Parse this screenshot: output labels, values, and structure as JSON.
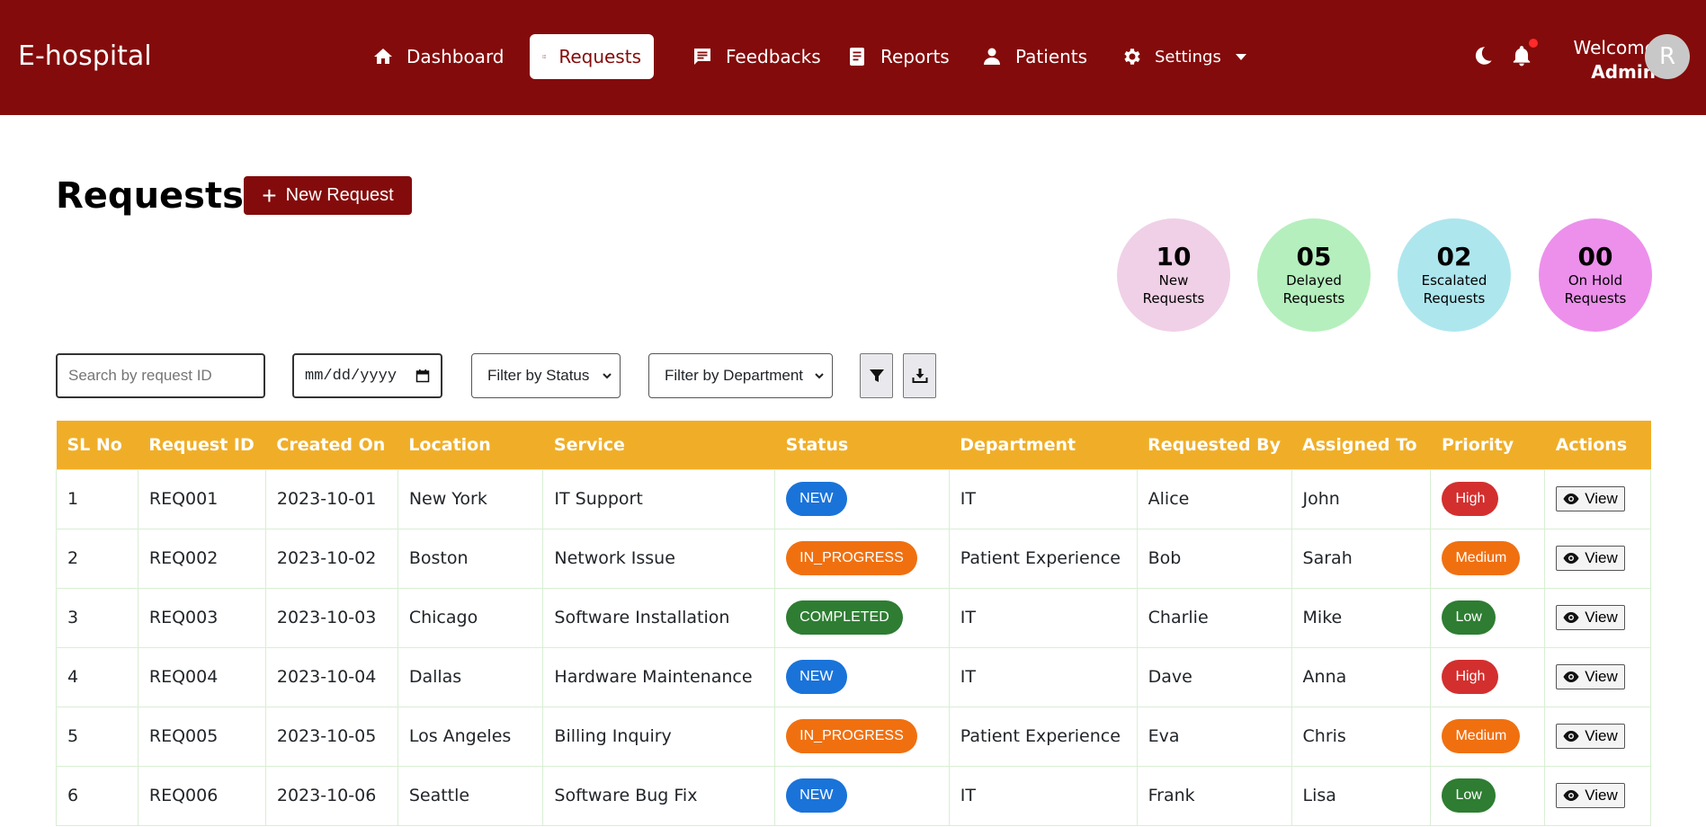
{
  "brand": "E-hospital",
  "nav": {
    "dashboard": "Dashboard",
    "requests": "Requests",
    "feedbacks": "Feedbacks",
    "reports": "Reports",
    "patients": "Patients",
    "settings": "Settings"
  },
  "user": {
    "welcome": "Welcome",
    "name": "Admin",
    "avatar_initial": "R"
  },
  "page": {
    "title": "Requests",
    "new_button": "New Request"
  },
  "stats": [
    {
      "num": "10",
      "label": "New Requests",
      "color": "#f0d0e6"
    },
    {
      "num": "05",
      "label": "Delayed Requests",
      "color": "#b5efbd"
    },
    {
      "num": "02",
      "label": "Escalated Requests",
      "color": "#aee6ee"
    },
    {
      "num": "00",
      "label": "On Hold Requests",
      "color": "#ec90ec"
    }
  ],
  "filters": {
    "search_placeholder": "Search by request ID",
    "date_placeholder": "mm/dd/yyyy",
    "status": "Filter by Status",
    "department": "Filter by Department"
  },
  "table": {
    "headers": [
      "SL No",
      "Request ID",
      "Created On",
      "Location",
      "Service",
      "Status",
      "Department",
      "Requested By",
      "Assigned To",
      "Priority",
      "Actions"
    ],
    "view_label": "View",
    "rows": [
      {
        "sl": "1",
        "id": "REQ001",
        "created": "2023-10-01",
        "location": "New York",
        "service": "IT Support",
        "status": "NEW",
        "department": "IT",
        "requested_by": "Alice",
        "assigned_to": "John",
        "priority": "High"
      },
      {
        "sl": "2",
        "id": "REQ002",
        "created": "2023-10-02",
        "location": "Boston",
        "service": "Network Issue",
        "status": "IN_PROGRESS",
        "department": "Patient Experience",
        "requested_by": "Bob",
        "assigned_to": "Sarah",
        "priority": "Medium"
      },
      {
        "sl": "3",
        "id": "REQ003",
        "created": "2023-10-03",
        "location": "Chicago",
        "service": "Software Installation",
        "status": "COMPLETED",
        "department": "IT",
        "requested_by": "Charlie",
        "assigned_to": "Mike",
        "priority": "Low"
      },
      {
        "sl": "4",
        "id": "REQ004",
        "created": "2023-10-04",
        "location": "Dallas",
        "service": "Hardware Maintenance",
        "status": "NEW",
        "department": "IT",
        "requested_by": "Dave",
        "assigned_to": "Anna",
        "priority": "High"
      },
      {
        "sl": "5",
        "id": "REQ005",
        "created": "2023-10-05",
        "location": "Los Angeles",
        "service": "Billing Inquiry",
        "status": "IN_PROGRESS",
        "department": "Patient Experience",
        "requested_by": "Eva",
        "assigned_to": "Chris",
        "priority": "Medium"
      },
      {
        "sl": "6",
        "id": "REQ006",
        "created": "2023-10-06",
        "location": "Seattle",
        "service": "Software Bug Fix",
        "status": "NEW",
        "department": "IT",
        "requested_by": "Frank",
        "assigned_to": "Lisa",
        "priority": "Low"
      }
    ]
  },
  "colors": {
    "brand": "#840b0b",
    "header": "#f0ae28",
    "status_new": "#1a73d9",
    "status_in_progress": "#f07010",
    "status_completed": "#2e7d32",
    "priority_high": "#d32f2f",
    "priority_medium": "#f07010",
    "priority_low": "#2e7d32"
  }
}
